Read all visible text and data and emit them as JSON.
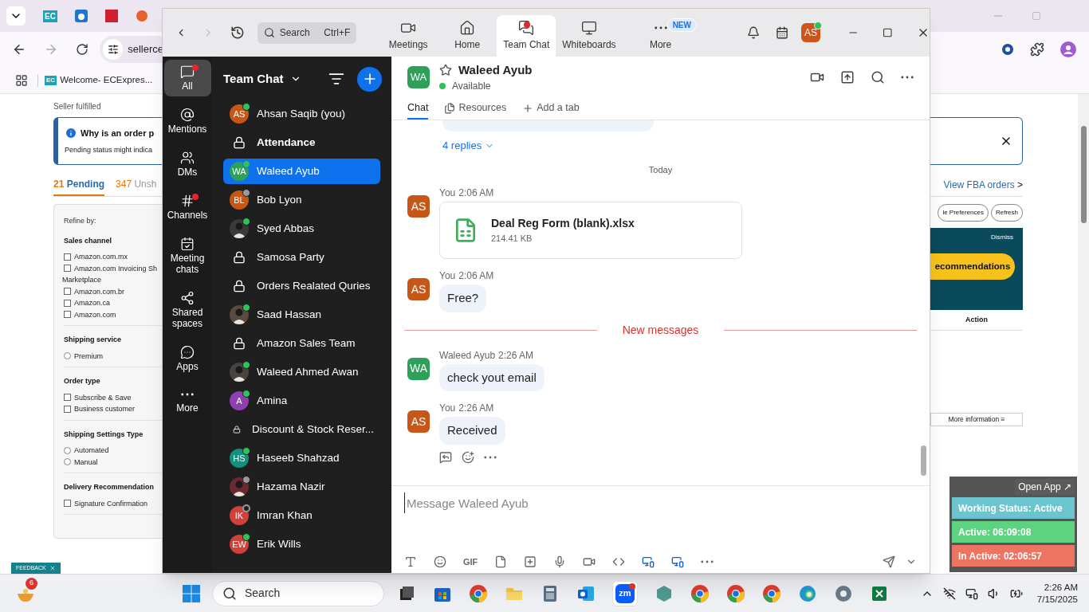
{
  "browser": {
    "pinned_favicon": "EC",
    "address": "sellerce",
    "bookmark": {
      "favicon": "EC",
      "label": "Welcome- ECExpres..."
    }
  },
  "seller_page": {
    "subtitle": "Seller fulfilled",
    "notice": {
      "title": "Why is an order p",
      "text": "Pending status might indica"
    },
    "tabs": [
      {
        "count": "21",
        "label": "Pending",
        "selected": true
      },
      {
        "count": "347",
        "label": "Unsh",
        "selected": false
      }
    ],
    "fba_link": "View FBA orders",
    "fba_arrow": ">",
    "refine": {
      "title": "Refine by:",
      "sections": [
        {
          "title": "Sales channel",
          "options": [
            {
              "kind": "checkbox",
              "lines": [
                "Amazon.com.mx"
              ],
              "checked": false
            },
            {
              "kind": "checkbox",
              "lines": [
                "Amazon.com Invoicing Sh",
                "Marketplace"
              ],
              "checked": false
            },
            {
              "kind": "checkbox",
              "lines": [
                "Amazon.com.br"
              ],
              "checked": false
            },
            {
              "kind": "checkbox",
              "lines": [
                "Amazon.ca"
              ],
              "checked": false
            },
            {
              "kind": "checkbox",
              "lines": [
                "Amazon.com"
              ],
              "checked": false
            }
          ]
        },
        {
          "title": "Shipping service",
          "options": [
            {
              "kind": "radio",
              "lines": [
                "Premium"
              ],
              "checked": false
            }
          ]
        },
        {
          "title": "Order type",
          "options": [
            {
              "kind": "checkbox",
              "lines": [
                "Subscribe & Save"
              ],
              "checked": false
            },
            {
              "kind": "checkbox",
              "lines": [
                "Business customer"
              ],
              "checked": false
            }
          ]
        },
        {
          "title": "Shipping Settings Type",
          "options": [
            {
              "kind": "radio",
              "lines": [
                "Automated"
              ],
              "checked": false
            },
            {
              "kind": "radio",
              "lines": [
                "Manual"
              ],
              "checked": false
            }
          ]
        },
        {
          "title": "Delivery Recommendation",
          "options": [
            {
              "kind": "checkbox",
              "lines": [
                "Signature Confirmation"
              ],
              "checked": false
            }
          ]
        }
      ]
    },
    "buttons": [
      "le Preferences",
      "Refresh"
    ],
    "promo": {
      "dismiss": "Dismiss",
      "button": "ecommendations"
    },
    "action_header": "Action",
    "more_info": "More information ≡",
    "feedback": "FEEDBACK"
  },
  "tracker": {
    "open_app": "Open App ↗",
    "statuses": [
      {
        "label": "Working Status: Active",
        "color": "#6cc4cf"
      },
      {
        "label": "Active: 06:09:08",
        "color": "#5dd27f"
      },
      {
        "label": "In Active: 02:06:57",
        "color": "#ee7462"
      }
    ]
  },
  "zoom": {
    "search": {
      "placeholder": "Search",
      "shortcut": "Ctrl+F"
    },
    "nav": [
      {
        "kind": "meetings",
        "label": "Meetings",
        "selected": false,
        "dot": false
      },
      {
        "kind": "home",
        "label": "Home",
        "selected": false,
        "dot": false
      },
      {
        "kind": "chat",
        "label": "Team Chat",
        "selected": true,
        "dot": true
      },
      {
        "kind": "whiteboards",
        "label": "Whiteboards",
        "selected": false,
        "dot": false
      },
      {
        "kind": "more",
        "label": "More",
        "selected": false,
        "dot": false,
        "badge": "NEW"
      }
    ],
    "user": {
      "initials": "AS",
      "presence": {
        "kind": "online"
      }
    },
    "rail": [
      {
        "kind": "all",
        "label": "All",
        "selected": true,
        "dot": true
      },
      {
        "kind": "mentions",
        "label": "Mentions",
        "selected": false,
        "dot": false
      },
      {
        "kind": "dms",
        "label": "DMs",
        "selected": false,
        "dot": false
      },
      {
        "kind": "channels",
        "label": "Channels",
        "selected": false,
        "dot": true
      },
      {
        "kind": "meetings",
        "label": "Meeting chats",
        "selected": false,
        "dot": false
      },
      {
        "kind": "shared",
        "label": "Shared spaces",
        "selected": false,
        "dot": false
      },
      {
        "kind": "apps",
        "label": "Apps",
        "selected": false,
        "dot": false
      },
      {
        "kind": "more",
        "label": "More",
        "selected": false,
        "dot": false
      }
    ],
    "list": {
      "title": "Team Chat",
      "items": [
        {
          "kind": "initials",
          "initials": "AS",
          "color": "#c75716",
          "name": "Ahsan Saqib (you)",
          "presence": {
            "kind": "online"
          },
          "bold": false,
          "selected": false
        },
        {
          "kind": "lock",
          "name": "Attendance",
          "bold": true,
          "selected": false
        },
        {
          "kind": "initials",
          "initials": "WA",
          "color": "#2fa05a",
          "name": "Waleed Ayub",
          "presence": {
            "kind": "online"
          },
          "bold": false,
          "selected": true
        },
        {
          "kind": "initials",
          "initials": "BL",
          "color": "#c75716",
          "name": "Bob Lyon",
          "presence": {
            "kind": "away"
          },
          "bold": false,
          "selected": false
        },
        {
          "color": "#3a3a3a",
          "name": "Syed Abbas",
          "presence": {
            "kind": "online"
          },
          "bold": false,
          "selected": false
        },
        {
          "kind": "lock",
          "name": "Samosa Party",
          "bold": false,
          "selected": false
        },
        {
          "kind": "lock",
          "name": "Orders Realated Quries",
          "bold": false,
          "selected": false
        },
        {
          "color": "#5a4a40",
          "name": "Saad Hassan",
          "presence": {
            "kind": "online"
          },
          "bold": false,
          "selected": false
        },
        {
          "kind": "lock",
          "name": "Amazon Sales Team",
          "bold": false,
          "selected": false
        },
        {
          "color": "#4a4440",
          "name": "Waleed Ahmed Awan",
          "presence": {
            "kind": "online"
          },
          "bold": false,
          "selected": false
        },
        {
          "kind": "initials",
          "initials": "A",
          "color": "#8e3fb0",
          "name": "Amina",
          "presence": {
            "kind": "online"
          },
          "bold": false,
          "selected": false
        },
        {
          "kind": "lock",
          "name": "Discount & Stock Reser...",
          "bold": false,
          "selected": false
        },
        {
          "kind": "initials",
          "initials": "HS",
          "color": "#14907e",
          "name": "Haseeb Shahzad",
          "presence": {
            "kind": "online"
          },
          "bold": false,
          "selected": false
        },
        {
          "color": "#6a2a30",
          "name": "Hazama Nazir",
          "presence": {
            "kind": "away"
          },
          "bold": false,
          "selected": false
        },
        {
          "kind": "initials",
          "initials": "IK",
          "color": "#d0413a",
          "name": "Imran Khan",
          "presence": {
            "kind": "offline"
          },
          "bold": false,
          "selected": false
        },
        {
          "kind": "initials",
          "initials": "EW",
          "color": "#d0413a",
          "name": "Erik Wills",
          "presence": {
            "kind": "online"
          },
          "bold": false,
          "selected": false
        }
      ]
    },
    "chat": {
      "contact": {
        "initials": "WA",
        "color": "#2fa05a",
        "name": "Waleed Ayub",
        "status": "Available"
      },
      "tabs": [
        {
          "kind": "chat",
          "label": "Chat",
          "selected": true
        },
        {
          "kind": "resources",
          "label": "Resources",
          "selected": false
        },
        {
          "kind": "add",
          "label": "Add a tab",
          "selected": false
        }
      ],
      "items": [
        {
          "kind": "replies",
          "text": "4 replies"
        },
        {
          "kind": "date",
          "text": "Today"
        },
        {
          "kind": "file",
          "sender": "You",
          "time": "2:06 AM",
          "initials": "AS",
          "color": "#c75716",
          "file_name": "Deal Reg Form (blank).xlsx",
          "file_size": "214.41 KB"
        },
        {
          "kind": "text",
          "sender": "You",
          "time": "2:06 AM",
          "initials": "AS",
          "color": "#c75716",
          "text": "Free?"
        },
        {
          "kind": "new",
          "text": "New messages"
        },
        {
          "kind": "text",
          "sender": "Waleed Ayub",
          "time": "2:26 AM",
          "initials": "WA",
          "color": "#2fa05a",
          "text": "check yout email"
        },
        {
          "kind": "text",
          "sender": "You",
          "time": "2:26 AM",
          "initials": "AS",
          "color": "#c75716",
          "text": "Received",
          "actions": true
        }
      ],
      "composer": {
        "placeholder": "Message Waleed Ayub",
        "gif": "GIF"
      }
    }
  },
  "taskbar": {
    "weather_badge": "6",
    "search": "Search",
    "zoom_label": "zm",
    "time": "2:26 AM",
    "date": "7/15/2025"
  }
}
